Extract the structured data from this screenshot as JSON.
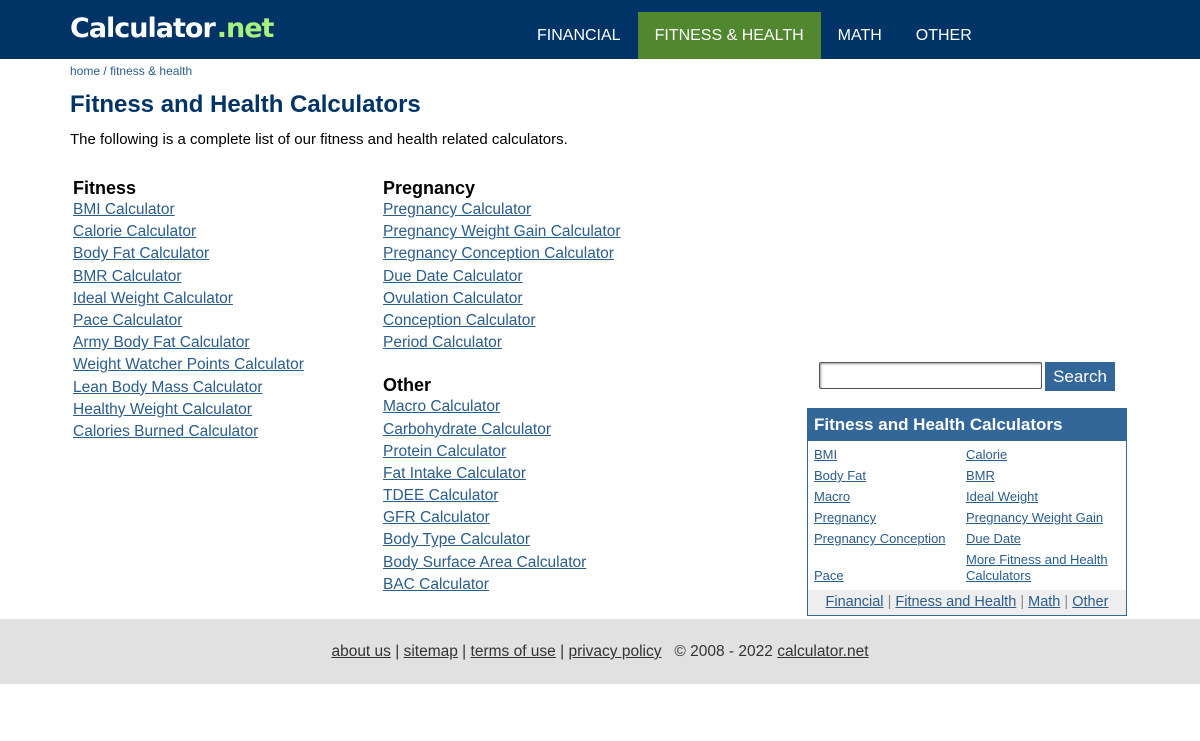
{
  "header": {
    "logo_main": "Calculator",
    "logo_suffix": ".net",
    "nav": [
      {
        "label": "FINANCIAL"
      },
      {
        "label": "FITNESS & HEALTH",
        "active": true
      },
      {
        "label": "MATH"
      },
      {
        "label": "OTHER"
      }
    ],
    "active_color": "#51872e",
    "bar_color": "#003366"
  },
  "breadcrumb": {
    "home": "home",
    "separator": "/",
    "current": "fitness & health"
  },
  "page": {
    "title": "Fitness and Health Calculators",
    "intro": "The following is a complete list of our fitness and health related calculators."
  },
  "fitness": {
    "heading": "Fitness",
    "links": [
      "BMI Calculator",
      "Calorie Calculator",
      "Body Fat Calculator",
      "BMR Calculator",
      "Ideal Weight Calculator",
      "Pace Calculator",
      "Army Body Fat Calculator",
      "Weight Watcher Points Calculator",
      "Lean Body Mass Calculator",
      "Healthy Weight Calculator",
      "Calories Burned Calculator"
    ]
  },
  "pregnancy": {
    "heading": "Pregnancy",
    "links": [
      "Pregnancy Calculator",
      "Pregnancy Weight Gain Calculator",
      "Pregnancy Conception Calculator",
      "Due Date Calculator",
      "Ovulation Calculator",
      "Conception Calculator",
      "Period Calculator"
    ]
  },
  "other": {
    "heading": "Other",
    "links": [
      "Macro Calculator",
      "Carbohydrate Calculator",
      "Protein Calculator",
      "Fat Intake Calculator",
      "TDEE Calculator",
      "GFR Calculator",
      "Body Type Calculator",
      "Body Surface Area Calculator",
      "BAC Calculator"
    ]
  },
  "search": {
    "value": "",
    "button": "Search"
  },
  "sidebox": {
    "title": "Fitness and Health Calculators",
    "links": [
      "BMI",
      "Calorie",
      "Body Fat",
      "BMR",
      "Macro",
      "Ideal Weight",
      "Pregnancy",
      "Pregnancy Weight Gain",
      "Pregnancy Conception",
      "Due Date",
      "Pace",
      "More Fitness and Health Calculators"
    ],
    "footer_links": [
      "Financial",
      "Fitness and Health",
      "Math",
      "Other"
    ],
    "footer_separator": "|"
  },
  "footer": {
    "links": [
      "about us",
      "sitemap",
      "terms of use",
      "privacy policy"
    ],
    "separator": "|",
    "copyright": "© 2008 - 2022",
    "site": "calculator.net"
  }
}
